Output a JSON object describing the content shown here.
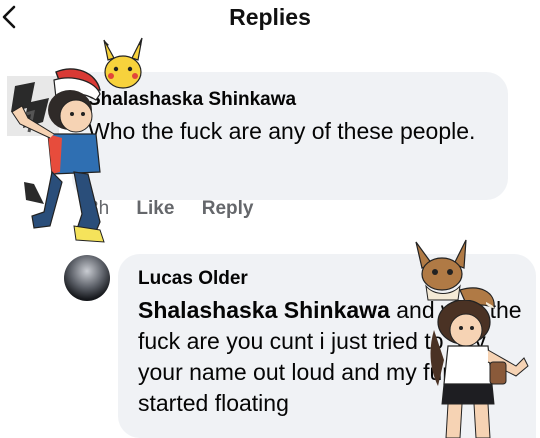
{
  "header": {
    "title": "Replies"
  },
  "comments": [
    {
      "author": "Shalashaska Shinkawa",
      "text": "Who the fuck are any of these people.",
      "time": "3h",
      "like_label": "Like",
      "reply_label": "Reply"
    },
    {
      "author": "Lucas Older",
      "mention": "Shalashaska Shinkawa",
      "text": " and who the fuck are you cunt i just tried to say your name out loud and my furniture started floating"
    }
  ],
  "icons": {
    "back": "chevron-left-icon",
    "stickers": [
      "pikachu-sticker",
      "trainer-boy-sticker",
      "eevee-sticker",
      "trainer-girl-sticker"
    ]
  },
  "colors": {
    "bubble": "#f0f2f5",
    "meta": "#65676b"
  }
}
